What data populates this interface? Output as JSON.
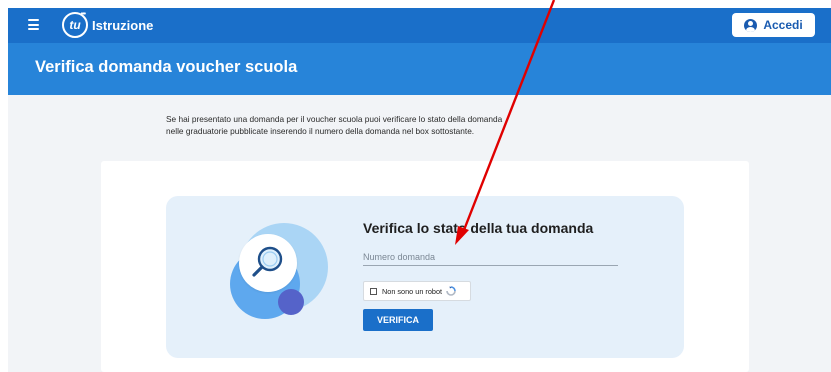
{
  "navbar": {
    "logo_mark": "tu",
    "logo_text": "Istruzione",
    "login_label": "Accedi"
  },
  "page": {
    "title": "Verifica domanda voucher scuola",
    "intro_line1": "Se hai presentato una domanda per il voucher scuola puoi verificare lo stato della domanda",
    "intro_line2": "nelle graduatorie pubblicate inserendo il numero della domanda nel box sottostante."
  },
  "form": {
    "title": "Verifica lo stato della tua domanda",
    "input_placeholder": "Numero domanda",
    "input_value": "",
    "captcha_label": "Non sono un robot",
    "captcha_checked": false,
    "submit_label": "VERIFICA"
  },
  "colors": {
    "navbar": "#1a6fc9",
    "header_band": "#2784d9",
    "panel": "#e5f0fa",
    "annotation_arrow": "#e00000"
  },
  "icons": [
    "menu-icon",
    "user-icon",
    "magnifier-icon",
    "recaptcha-icon",
    "annotation-arrow"
  ]
}
